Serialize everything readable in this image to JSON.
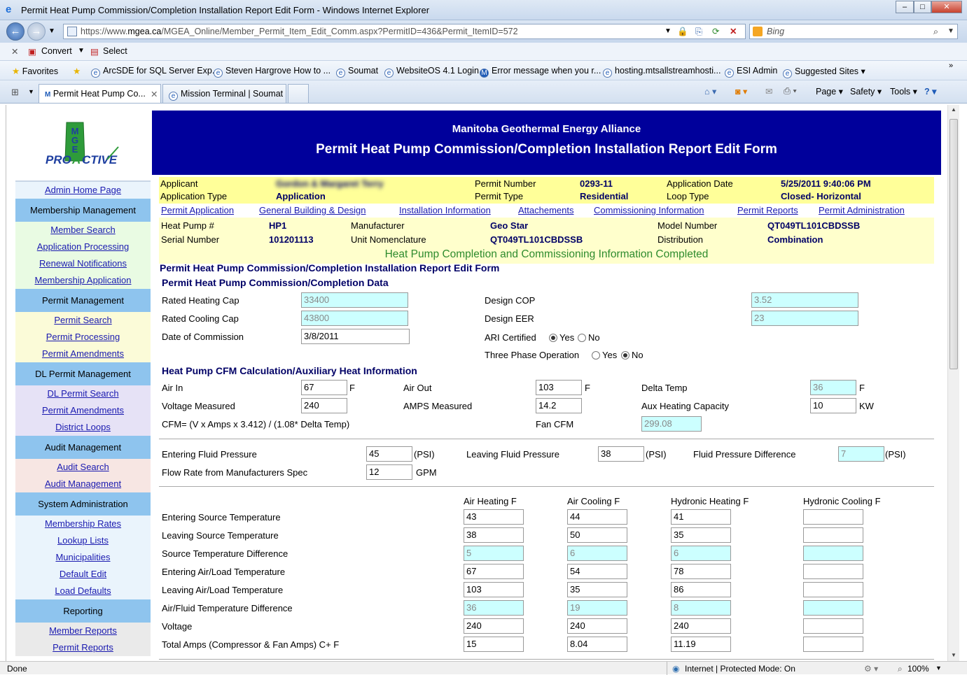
{
  "window": {
    "title": "Permit Heat Pump Commission/Completion Installation Report Edit Form - Windows Internet Explorer",
    "min": "–",
    "max": "□",
    "close": "✕"
  },
  "address": {
    "url_prefix": "https://www.",
    "url_domain": "mgea.ca",
    "url_rest": "/MGEA_Online/Member_Permit_Item_Edit_Comm.aspx?PermitID=436&Permit_ItemID=572",
    "search_placeholder": "Bing"
  },
  "cmdbar": {
    "convert": "Convert",
    "select": "Select"
  },
  "favorites": {
    "label": "Favorites",
    "items": [
      "ArcSDE for SQL Server Exp...",
      "Steven Hargrove  How to ...",
      "Soumat",
      "WebsiteOS 4.1 Login",
      "Error message when you r...",
      "hosting.mtsallstreamhosti...",
      "ESI Admin",
      "Suggested Sites ▾"
    ]
  },
  "tabs": [
    {
      "label": "Permit Heat Pump Co..."
    },
    {
      "label": "Mission Terminal | Soumat"
    }
  ],
  "tools": {
    "page": "Page ▾",
    "safety": "Safety ▾",
    "tools": "Tools ▾"
  },
  "status": {
    "left": "Done",
    "zone": "Internet | Protected Mode: On",
    "zoom": "100%"
  },
  "sidebar": {
    "admin_home": "Admin Home Page",
    "membership_head": "Membership Management",
    "membership_links": [
      "Member Search",
      "Application Processing",
      "Renewal Notifications",
      "Membership Application"
    ],
    "permit_head": "Permit Management",
    "permit_links": [
      "Permit Search",
      "Permit Processing",
      "Permit Amendments"
    ],
    "dl_head": "DL Permit Management",
    "dl_links": [
      "DL Permit Search",
      "Permit Amendments",
      "District Loops"
    ],
    "audit_head": "Audit Management",
    "audit_links": [
      "Audit Search",
      "Audit Management"
    ],
    "sys_head": "System Administration",
    "sys_links": [
      "Membership Rates",
      "Lookup Lists",
      "Municipalities",
      "Default Edit",
      "Load Defaults"
    ],
    "report_head": "Reporting",
    "report_links": [
      "Member Reports",
      "Permit Reports"
    ],
    "logo_text": "PROACTIVE",
    "logo_letters": "MGEA"
  },
  "banner": {
    "org": "Manitoba Geothermal Energy Alliance",
    "form_title": "Permit Heat Pump Commission/Completion Installation Report Edit Form"
  },
  "permit": {
    "applicant_label": "Applicant",
    "applicant_value": "Gordon & Margaret Terry",
    "permit_number_label": "Permit Number",
    "permit_number": "0293-11",
    "app_date_label": "Application Date",
    "app_date": "5/25/2011 9:40:06 PM",
    "app_type_label": "Application Type",
    "app_type": "Application",
    "permit_type_label": "Permit Type",
    "permit_type": "Residential",
    "loop_type_label": "Loop Type",
    "loop_type": "Closed- Horizontal"
  },
  "navlinks": [
    "Permit Application",
    "General Building & Design",
    "Installation Information",
    "Attachements",
    "Commissioning Information",
    "Permit Reports",
    "Permit Administration"
  ],
  "unit": {
    "hp_label": "Heat Pump #",
    "hp": "HP1",
    "mfr_label": "Manufacturer",
    "mfr": "Geo Star",
    "model_label": "Model Number",
    "model": "QT049TL101CBDSSB",
    "serial_label": "Serial Number",
    "serial": "101201113",
    "nomen_label": "Unit Nomenclature",
    "nomen": "QT049TL101CBDSSB",
    "dist_label": "Distribution",
    "dist": "Combination",
    "status": "Heat Pump Completion and Commissioning Information Completed"
  },
  "form": {
    "title": "Permit Heat Pump Commission/Completion Installation Report Edit Form",
    "data_heading": "Permit Heat Pump Commission/Completion Data",
    "rhc_label": "Rated Heating Cap",
    "rhc": "33400",
    "rcc_label": "Rated Cooling Cap",
    "rcc": "43800",
    "doc_label": "Date of Commission",
    "doc": "3/8/2011",
    "cop_label": "Design COP",
    "cop": "3.52",
    "eer_label": "Design EER",
    "eer": "23",
    "ari_label": "ARI Certified",
    "three_label": "Three Phase Operation",
    "yes": "Yes",
    "no": "No",
    "cfm_heading": "Heat Pump CFM Calculation/Auxiliary Heat Information",
    "airin_label": "Air In",
    "airin": "67",
    "airout_label": "Air Out",
    "airout": "103",
    "delta_label": "Delta Temp",
    "delta": "36",
    "f": "F",
    "volt_label": "Voltage Measured",
    "volt": "240",
    "amps_label": "AMPS Measured",
    "amps": "14.2",
    "aux_label": "Aux Heating Capacity",
    "aux": "10",
    "kw": "KW",
    "cfm_formula": "CFM= (V x Amps x 3.412) / (1.08* Delta Temp)",
    "fancfm_label": "Fan CFM",
    "fancfm": "299.08",
    "efp_label": "Entering Fluid Pressure",
    "efp": "45",
    "lfp_label": "Leaving Fluid Pressure",
    "lfp": "38",
    "fpd_label": "Fluid Pressure Difference",
    "fpd": "7",
    "psi": "(PSI)",
    "flow_label": "Flow Rate from Manufacturers Spec",
    "flow": "12",
    "gpm": "GPM"
  },
  "temps": {
    "headers": [
      "Air Heating F",
      "Air Cooling F",
      "Hydronic Heating F",
      "Hydronic Cooling F"
    ],
    "rows": [
      {
        "label": "Entering Source Temperature",
        "vals": [
          "43",
          "44",
          "41",
          ""
        ]
      },
      {
        "label": "Leaving Source Temperature",
        "vals": [
          "38",
          "50",
          "35",
          ""
        ]
      },
      {
        "label": "Source Temperature Difference",
        "vals": [
          "5",
          "6",
          "6",
          ""
        ]
      },
      {
        "label": "Entering Air/Load Temperature",
        "vals": [
          "67",
          "54",
          "78",
          ""
        ]
      },
      {
        "label": "Leaving Air/Load Temperature",
        "vals": [
          "103",
          "35",
          "86",
          ""
        ]
      },
      {
        "label": "Air/Fluid Temperature Difference",
        "vals": [
          "36",
          "19",
          "8",
          ""
        ]
      },
      {
        "label": "Voltage",
        "vals": [
          "240",
          "240",
          "240",
          ""
        ]
      },
      {
        "label": "Total Amps (Compressor & Fan Amps) C+ F",
        "vals": [
          "15",
          "8.04",
          "11.19",
          ""
        ]
      }
    ]
  }
}
